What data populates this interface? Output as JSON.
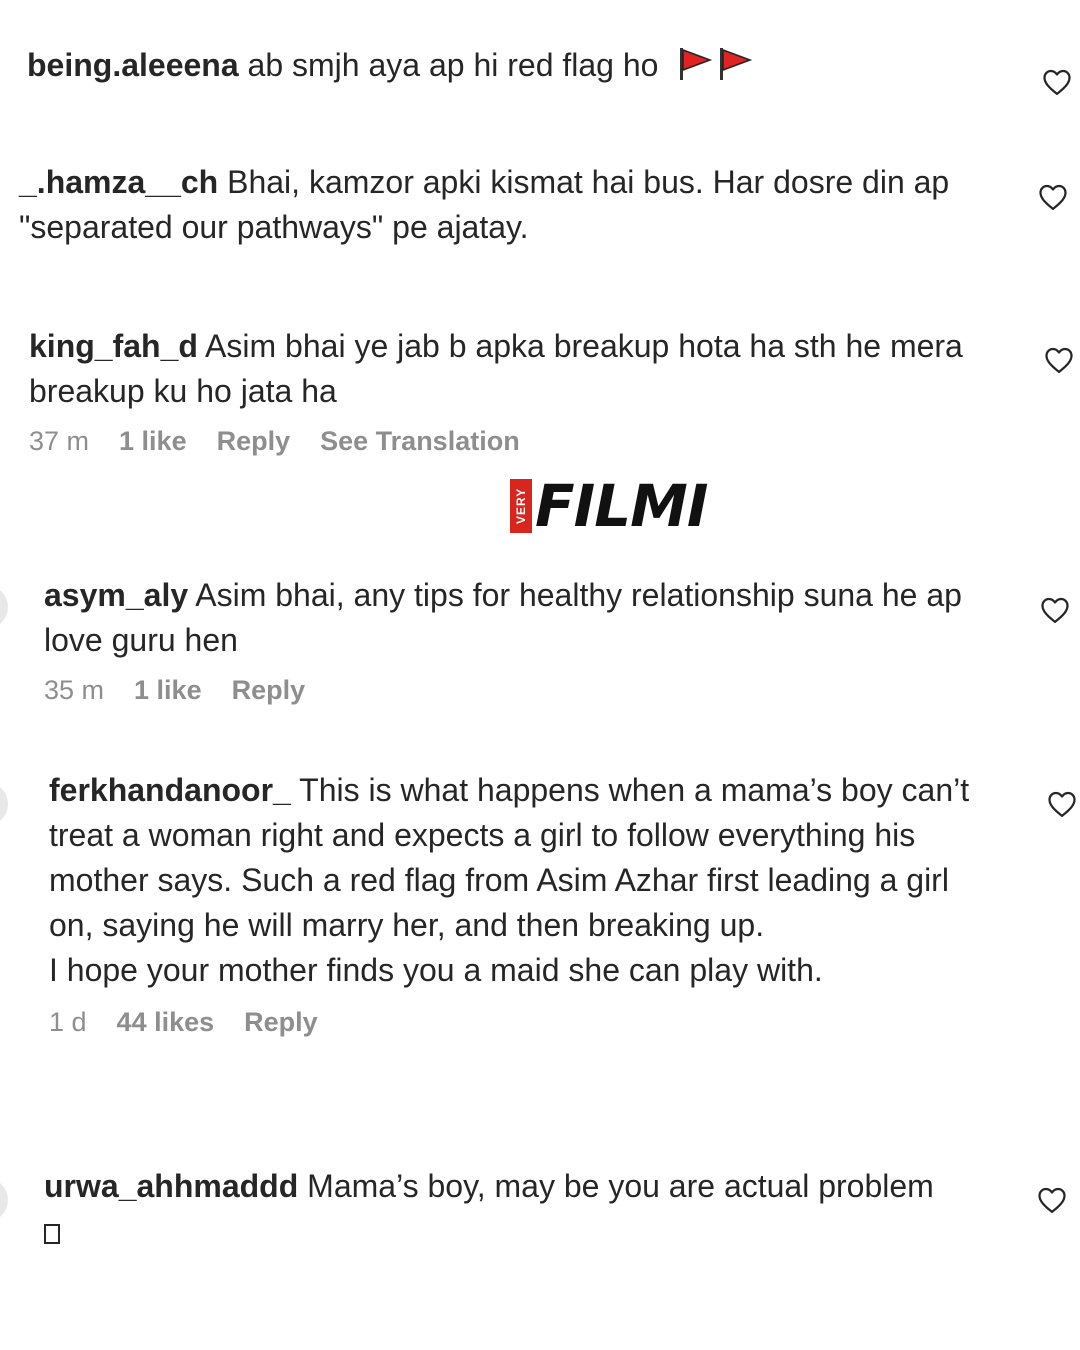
{
  "comments": [
    {
      "username": "being.aleeena",
      "text": "ab smjh aya ap hi red flag ho",
      "icons": [
        "red-flag-icon",
        "red-flag-icon"
      ]
    },
    {
      "username": "_.hamza__ch",
      "text": "Bhai, kamzor apki kismat hai bus. Har dosre din ap \"separated our pathways\" pe ajatay."
    },
    {
      "username": "king_fah_d",
      "text": "Asim bhai ye jab b apka breakup hota ha sth he mera breakup ku ho jata ha",
      "time": "37 m",
      "likes": "1 like",
      "reply": "Reply",
      "translate": "See Translation"
    },
    {
      "username": "asym_aly",
      "text": "Asim bhai, any tips for healthy relationship suna he ap love guru hen",
      "time": "35 m",
      "likes": "1 like",
      "reply": "Reply"
    },
    {
      "username": "ferkhandanoor_",
      "text": "This is what happens when a mama’s boy can’t treat a woman right and expects a girl to follow everything his mother says. Such a red flag from Asim Azhar first leading a girl on, saying he will marry her, and then breaking up.",
      "text2": "I hope your mother finds you a maid she can play with.",
      "time": "1 d",
      "likes": "44 likes",
      "reply": "Reply"
    },
    {
      "username": "urwa_ahhmaddd",
      "text": "Mama’s boy, may be you are actual problem"
    }
  ],
  "logo": {
    "very": "VERY",
    "filmi": "FILMI"
  },
  "colors": {
    "text": "#262626",
    "meta": "#8e8e8e",
    "flag": "#e02424",
    "logo_red": "#d7261e"
  }
}
